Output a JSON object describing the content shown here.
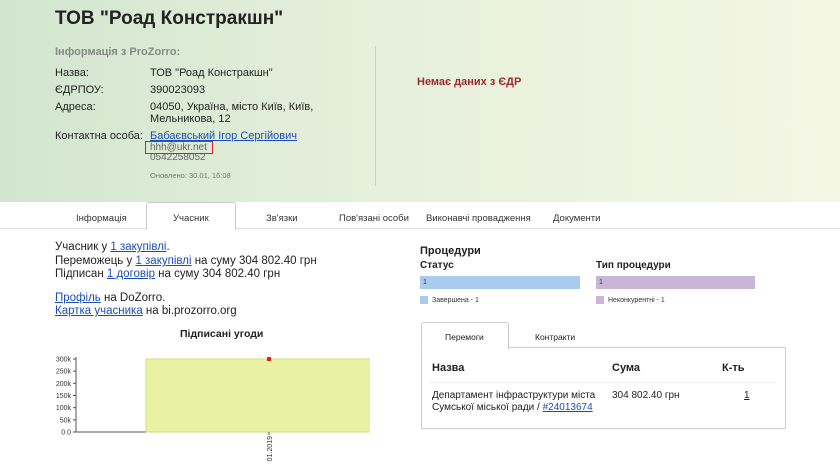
{
  "company": {
    "title": "ТОВ \"Роад Констракшн\""
  },
  "info": {
    "heading": "Інформація з ProZorro:",
    "name_label": "Назва:",
    "name_value": "ТОВ \"Роад Констракшн\"",
    "edrpou_label": "ЄДРПОУ:",
    "edrpou_value": "390023093",
    "address_label": "Адреса:",
    "address_value": "04050, Україна, місто Київ, Київ, Мельникова, 12",
    "contact_label": "Контактна особа:",
    "contact_name": "Бабаєвський Ігор Сергійович",
    "contact_email": "hhh@ukr.net",
    "contact_phone": "0542258052",
    "updated": "Оновлено: 30.01, 16:08"
  },
  "edr": {
    "message": "Немає даних з ЄДР"
  },
  "tabs": [
    "Інформація",
    "Учасник",
    "Зв'язки",
    "Пов'язані особи",
    "Виконавчі провадження",
    "Документи"
  ],
  "participant": {
    "line1_prefix": "Учасник у ",
    "line1_link": "1 закупівлі",
    "line1_suffix": ".",
    "line2_prefix": "Переможець у ",
    "line2_link": "1 закупівлі",
    "line2_suffix": " на суму 304 802.40 грн",
    "line3_prefix": "Підписан ",
    "line3_link": "1 договір",
    "line3_suffix": " на суму 304 802.40 грн",
    "profile_link": "Профіль",
    "profile_suffix": " на DoZorro.",
    "card_link": "Картка учасника",
    "card_suffix": " на bi.prozorro.org"
  },
  "chart_data": {
    "type": "bar",
    "title": "Підписані угоди",
    "categories": [
      "01.2019"
    ],
    "values": [
      304802.4
    ],
    "ylim": [
      0,
      300000
    ],
    "yticks": [
      "0.0",
      "50k",
      "100k",
      "150k",
      "200k",
      "250k",
      "300k"
    ],
    "colors": {
      "bar": "#e8f2a2",
      "bar_border": "#cfe07a",
      "marker": "#e02020"
    }
  },
  "procedures": {
    "title": "Процедури",
    "status_label": "Статус",
    "type_label": "Тип процедури",
    "status_bar_value": "1",
    "type_bar_value": "1",
    "status_legend": "Завершена - 1",
    "type_legend": "Неконкурентні - 1",
    "colors": {
      "status": "#a9cbed",
      "type": "#c9b5d8"
    }
  },
  "winnings": {
    "tabs": [
      "Перемоги",
      "Контракти"
    ],
    "headers": [
      "Назва",
      "Сума",
      "К-ть"
    ],
    "rows": [
      {
        "name_line1": "Департамент інфраструктури міста",
        "name_line2": "Сумської міської ради / ",
        "name_link": "#24013674",
        "sum": "304 802.40 грн",
        "count": "1"
      }
    ]
  }
}
